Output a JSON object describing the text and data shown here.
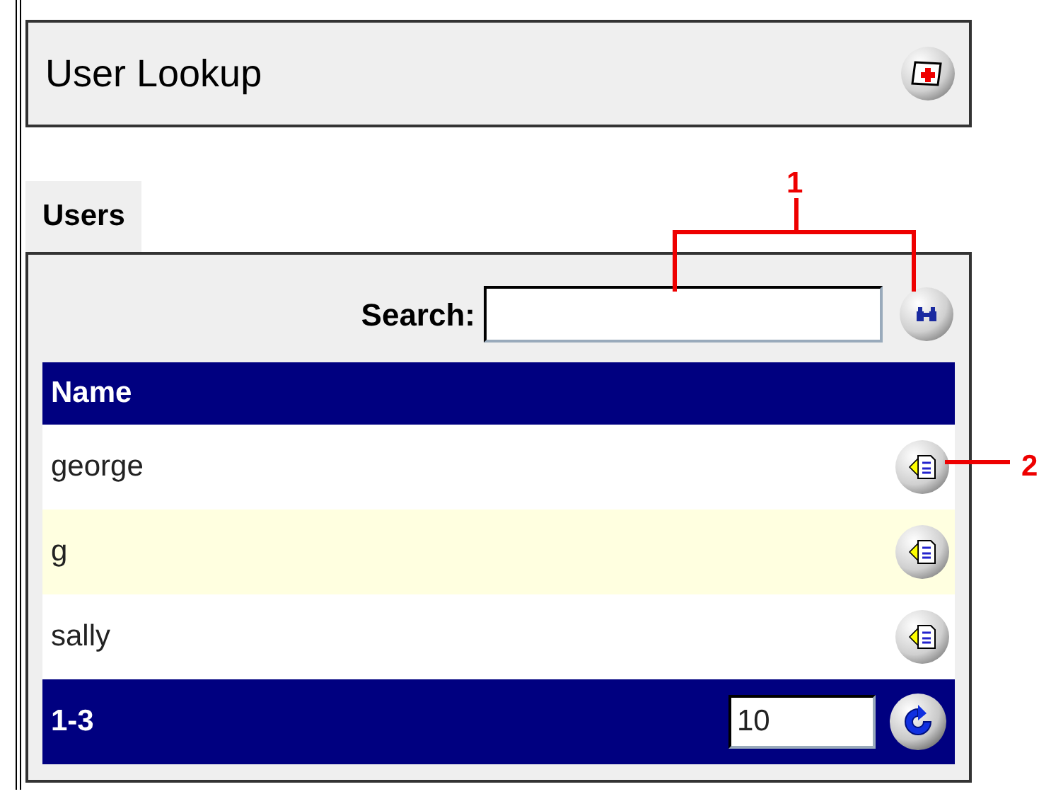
{
  "header": {
    "title": "User Lookup"
  },
  "tabs": [
    {
      "label": "Users",
      "selected": true
    }
  ],
  "search": {
    "label": "Search:"
  },
  "table": {
    "columns": [
      "Name"
    ],
    "rows": [
      {
        "name": "george"
      },
      {
        "name": "g"
      },
      {
        "name": "sally"
      }
    ]
  },
  "footer": {
    "range": "1-3",
    "page_size": "10"
  },
  "annotations": [
    {
      "label": "1",
      "kind": "bracket"
    },
    {
      "label": "2",
      "kind": "line"
    }
  ]
}
